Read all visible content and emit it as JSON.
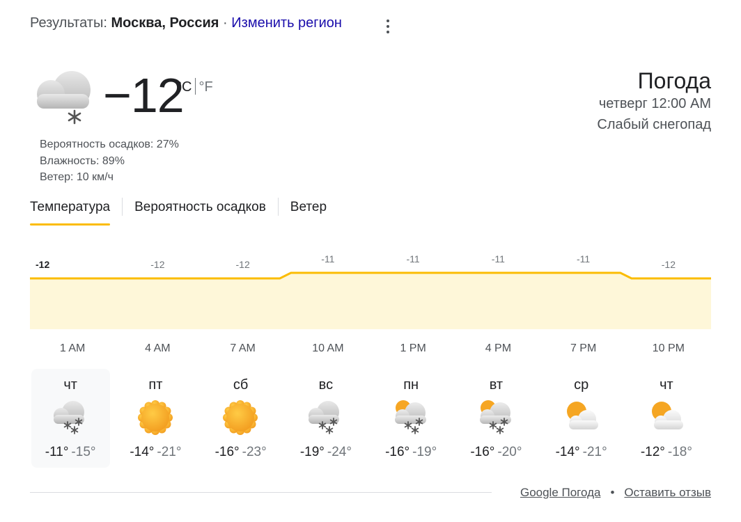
{
  "header": {
    "results_prefix": "Результаты:",
    "location": "Москва, Россия",
    "separator": "·",
    "change_region": "Изменить регион"
  },
  "current": {
    "temp": "−12",
    "unit_c": "°C",
    "unit_f": "°F",
    "icon": "cloud-snow-icon",
    "precip": "Вероятность осадков: 27%",
    "humidity": "Влажность: 89%",
    "wind": "Ветер: 10 км/ч"
  },
  "title_block": {
    "title": "Погода",
    "daytime": "четверг 12:00 AM",
    "condition": "Слабый снегопад"
  },
  "tabs": [
    {
      "label": "Температура",
      "active": true
    },
    {
      "label": "Вероятность осадков",
      "active": false
    },
    {
      "label": "Ветер",
      "active": false
    }
  ],
  "chart_data": {
    "type": "area",
    "x": [
      "1 AM",
      "4 AM",
      "7 AM",
      "10 AM",
      "1 PM",
      "4 PM",
      "7 PM",
      "10 PM"
    ],
    "values": [
      -12,
      -12,
      -12,
      -11,
      -11,
      -11,
      -11,
      -12
    ],
    "data_labels": [
      "-12",
      "-12",
      "-12",
      "-11",
      "-11",
      "-11",
      "-11",
      "-12"
    ],
    "line_color": "#fbbc04",
    "fill_color": "#fef7d9"
  },
  "days": [
    {
      "name": "чт",
      "icon": "cloud-snow-icon",
      "hi": "-11°",
      "lo": "-15°",
      "selected": true
    },
    {
      "name": "пт",
      "icon": "sun-icon",
      "hi": "-14°",
      "lo": "-21°",
      "selected": false
    },
    {
      "name": "сб",
      "icon": "sun-icon",
      "hi": "-16°",
      "lo": "-23°",
      "selected": false
    },
    {
      "name": "вс",
      "icon": "cloud-snow-icon",
      "hi": "-19°",
      "lo": "-24°",
      "selected": false
    },
    {
      "name": "пн",
      "icon": "sun-cloud-snow-icon",
      "hi": "-16°",
      "lo": "-19°",
      "selected": false
    },
    {
      "name": "вт",
      "icon": "sun-cloud-snow-icon",
      "hi": "-16°",
      "lo": "-20°",
      "selected": false
    },
    {
      "name": "ср",
      "icon": "partly-cloudy-icon",
      "hi": "-14°",
      "lo": "-21°",
      "selected": false
    },
    {
      "name": "чт",
      "icon": "partly-cloudy-icon",
      "hi": "-12°",
      "lo": "-18°",
      "selected": false
    }
  ],
  "footer": {
    "source": "Google Погода",
    "dot": "•",
    "feedback": "Оставить отзыв"
  }
}
